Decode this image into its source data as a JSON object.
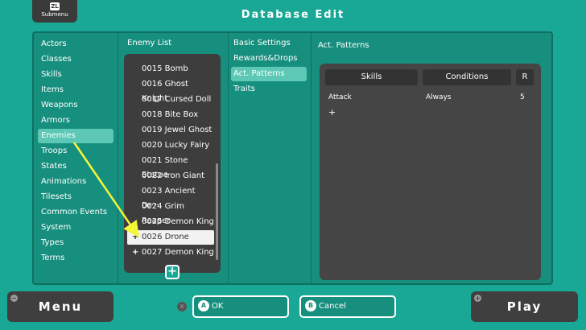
{
  "submenu": {
    "key": "ZL",
    "label": "Submenu"
  },
  "title": "Database Edit",
  "categories": [
    "Actors",
    "Classes",
    "Skills",
    "Items",
    "Weapons",
    "Armors",
    "Enemies",
    "Troops",
    "States",
    "Animations",
    "Tilesets",
    "Common Events",
    "System",
    "Types",
    "Terms"
  ],
  "selected_category": "Enemies",
  "enemy_list": {
    "header": "Enemy List",
    "items": [
      "0015 Bomb",
      "0016 Ghost Knight",
      "0017 Cursed Doll",
      "0018 Bite Box",
      "0019 Jewel Ghost",
      "0020 Lucky Fairy",
      "0021 Stone Statue",
      "0022 Iron Giant",
      "0023 Ancient Dr···",
      "0024 Grim Reaper",
      "0025 Demon King",
      "0026 Drone",
      "0027 Demon King"
    ],
    "selected": "0026 Drone",
    "add_symbol": "+",
    "item_plus": "+"
  },
  "tabs": [
    "Basic Settings",
    "Rewards&Drops",
    "Act. Patterns",
    "Traits"
  ],
  "selected_tab": "Act. Patterns",
  "act_patterns": {
    "header": "Act. Patterns",
    "columns": [
      "Skills",
      "Conditions",
      "R"
    ],
    "rows": [
      {
        "skill": "Attack",
        "condition": "Always",
        "rating": "5"
      }
    ],
    "add_symbol": "+"
  },
  "bottom": {
    "menu_label": "Menu",
    "menu_key": "−",
    "play_label": "Play",
    "play_key": "+",
    "x_key": "X",
    "ok_key": "A",
    "ok_label": "OK",
    "cancel_key": "B",
    "cancel_label": "Cancel"
  },
  "colors": {
    "background": "#1aa896",
    "panel": "#178f7e",
    "selection": "#5cc8b5",
    "arrow": "#f5f53a"
  }
}
